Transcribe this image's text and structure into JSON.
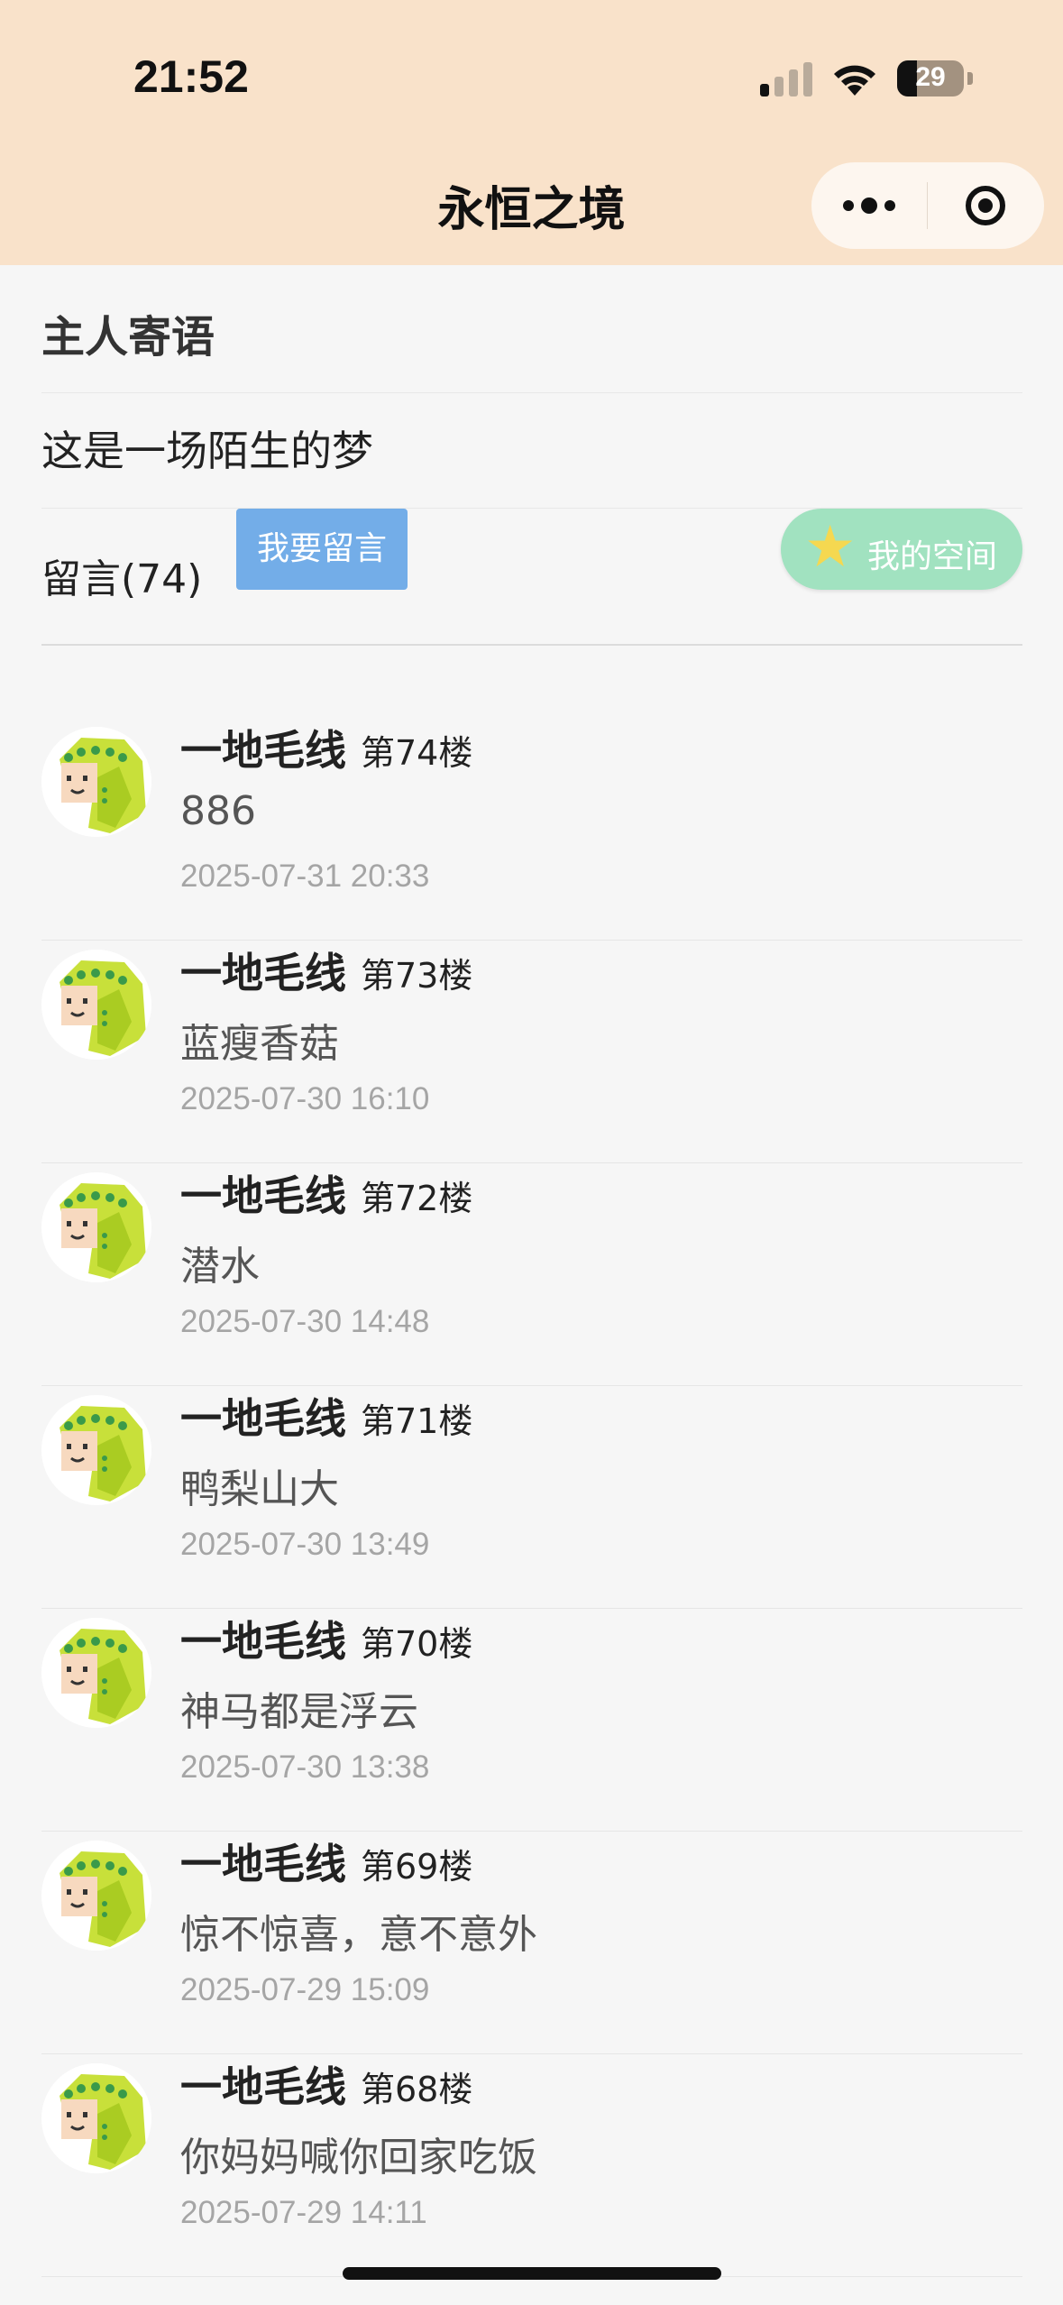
{
  "status_bar": {
    "time": "21:52",
    "battery": "29"
  },
  "nav": {
    "title": "永恒之境"
  },
  "host": {
    "section_title": "主人寄语",
    "message": "这是一场陌生的梦"
  },
  "messages_bar": {
    "count_label": "留言(74)",
    "leave_button": "我要留言",
    "my_space_button": "我的空间"
  },
  "colors": {
    "header_bg": "#f9e2ca",
    "leave_button_bg": "#73ade8",
    "my_space_bg": "#a1e2c0",
    "page_bg": "#f6f6f6"
  },
  "comments": [
    {
      "user": "一地毛线",
      "floor": "第74楼",
      "text": "886",
      "date": "2025-07-31 20:33"
    },
    {
      "user": "一地毛线",
      "floor": "第73楼",
      "text": "蓝瘦香菇",
      "date": "2025-07-30 16:10"
    },
    {
      "user": "一地毛线",
      "floor": "第72楼",
      "text": "潜水",
      "date": "2025-07-30 14:48"
    },
    {
      "user": "一地毛线",
      "floor": "第71楼",
      "text": "鸭梨山大",
      "date": "2025-07-30 13:49"
    },
    {
      "user": "一地毛线",
      "floor": "第70楼",
      "text": "神马都是浮云",
      "date": "2025-07-30 13:38"
    },
    {
      "user": "一地毛线",
      "floor": "第69楼",
      "text": "惊不惊喜，意不意外",
      "date": "2025-07-29 15:09"
    },
    {
      "user": "一地毛线",
      "floor": "第68楼",
      "text": "你妈妈喊你回家吃饭",
      "date": "2025-07-29 14:11"
    }
  ]
}
